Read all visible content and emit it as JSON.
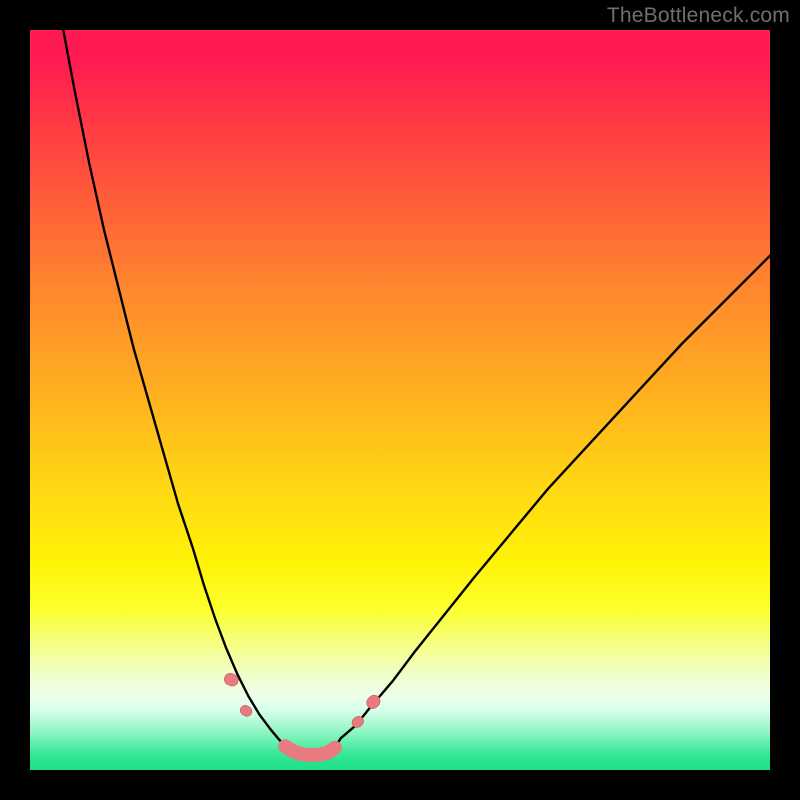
{
  "watermark": {
    "text": "TheBottleneck.com"
  },
  "colors": {
    "frame_bg": "#000000",
    "gradient_top": "#ff1a53",
    "gradient_bottom": "#1ee089",
    "curve_stroke": "#000000",
    "marker_fill": "#e77b7f",
    "marker_stroke": "#c9585c"
  },
  "chart_data": {
    "type": "line",
    "title": "",
    "xlabel": "",
    "ylabel": "",
    "xlim": [
      0,
      100
    ],
    "ylim": [
      0,
      100
    ],
    "series": [
      {
        "name": "left-curve",
        "x": [
          4.5,
          6,
          8,
          10,
          12,
          14,
          16,
          18,
          20,
          22,
          23.5,
          25,
          26.5,
          28,
          29.5,
          31,
          32.5,
          33.5
        ],
        "values": [
          100,
          92,
          82,
          73,
          65,
          57,
          50,
          43,
          36,
          30,
          25,
          20.5,
          16.5,
          13,
          10,
          7.5,
          5.5,
          4.3
        ]
      },
      {
        "name": "right-curve",
        "x": [
          42,
          44,
          46,
          49,
          52,
          56,
          60,
          65,
          70,
          76,
          82,
          88,
          94,
          100
        ],
        "values": [
          4.3,
          6.0,
          8.5,
          12,
          16,
          21,
          26,
          32,
          38,
          44.5,
          51,
          57.5,
          63.5,
          69.5
        ]
      },
      {
        "name": "valley-segment",
        "x": [
          33.5,
          34.5,
          35.8,
          37.2,
          38.8,
          40.2,
          41.2,
          42
        ],
        "values": [
          4.3,
          3.2,
          2.4,
          2.05,
          2.05,
          2.3,
          3.0,
          4.3
        ]
      }
    ],
    "markers": [
      {
        "series": "left-edge-marker-upper",
        "x": 27.2,
        "y": 12.2
      },
      {
        "series": "left-edge-marker-lower",
        "x": 29.2,
        "y": 8.0
      },
      {
        "series": "valley-marker",
        "x": 34.5,
        "y": 3.2
      },
      {
        "series": "valley-marker",
        "x": 35.8,
        "y": 2.4
      },
      {
        "series": "valley-marker",
        "x": 37.2,
        "y": 2.05
      },
      {
        "series": "valley-marker",
        "x": 38.8,
        "y": 2.05
      },
      {
        "series": "valley-marker",
        "x": 40.2,
        "y": 2.3
      },
      {
        "series": "valley-marker",
        "x": 41.2,
        "y": 3.0
      },
      {
        "series": "right-edge-marker-lower",
        "x": 44.3,
        "y": 6.5
      },
      {
        "series": "right-edge-marker-upper",
        "x": 46.4,
        "y": 9.2
      }
    ]
  }
}
